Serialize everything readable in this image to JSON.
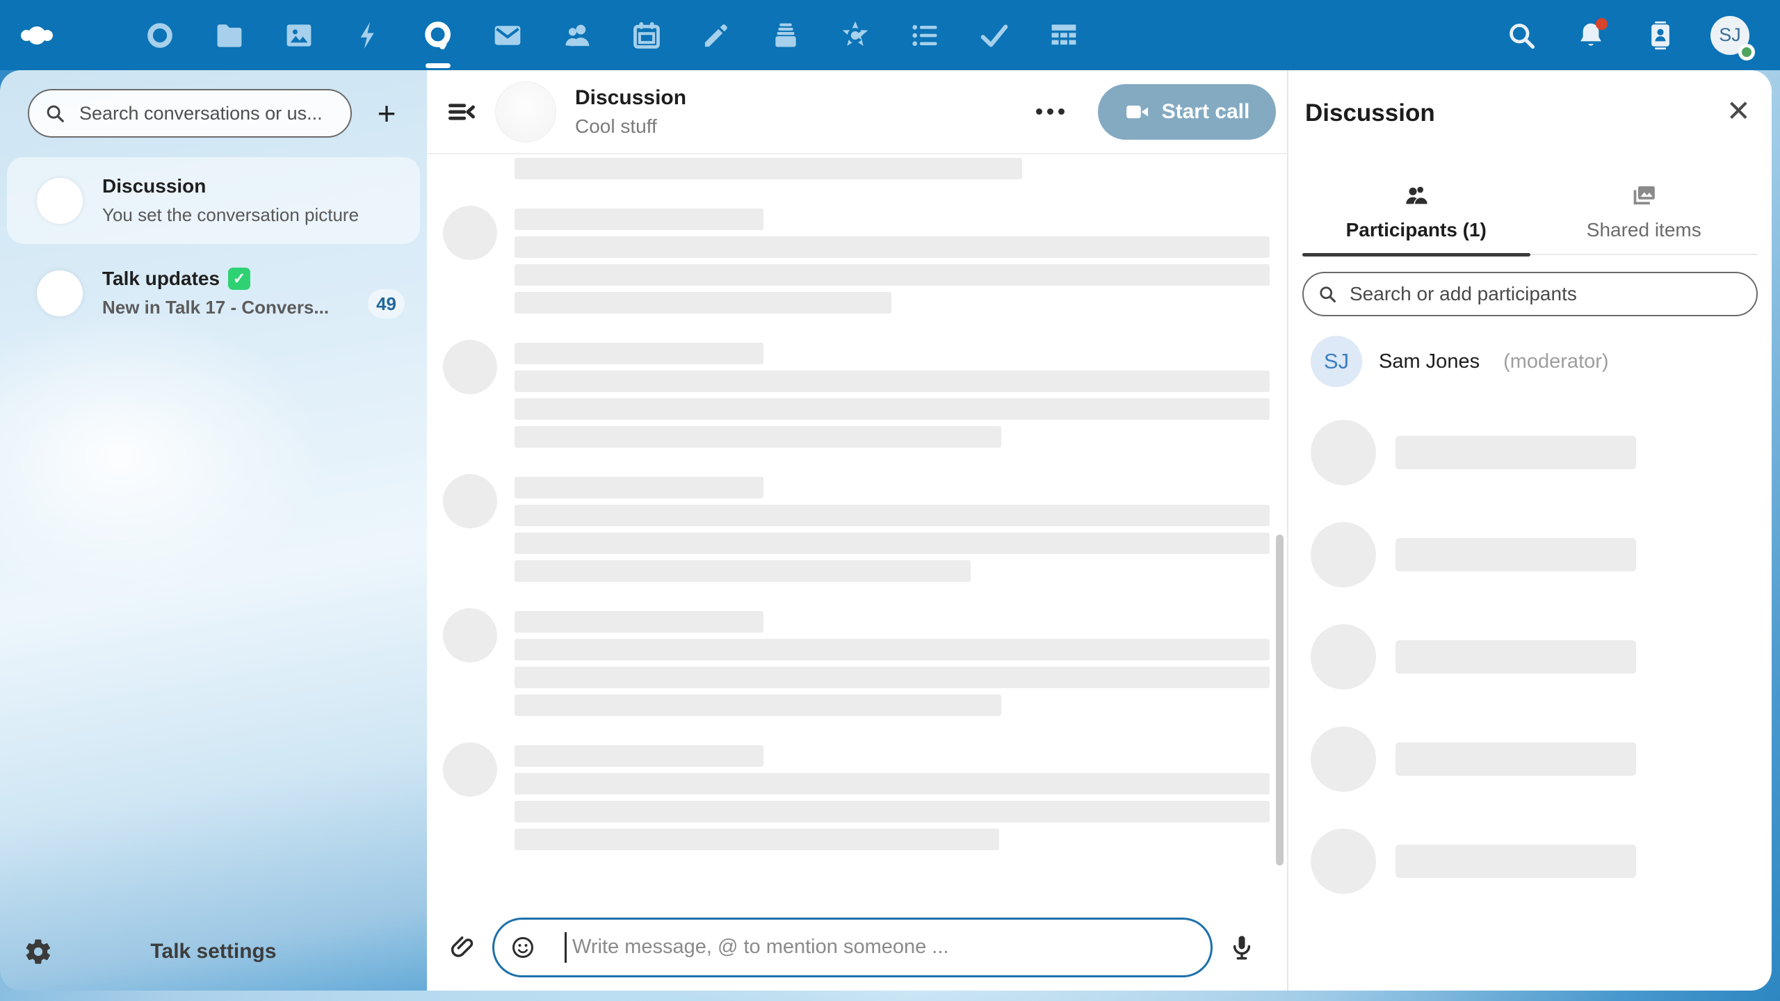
{
  "colors": {
    "primary_blue": "#0b73b6",
    "start_call_button": "#84aac2",
    "unread_badge_text": "#20689c",
    "check_badge_green": "#2fd273",
    "online_status_green": "#4fa45f",
    "notification_dot_red": "#d8432b",
    "selected_conversation_bg": "#dcebf6",
    "skeleton_gray": "#ececec"
  },
  "topbar": {
    "apps": [
      "dashboard",
      "files",
      "photos",
      "activity",
      "talk",
      "mail",
      "contacts",
      "calendar",
      "notes",
      "deck",
      "collectives",
      "tasks",
      "checks",
      "tables"
    ],
    "active_app": "talk",
    "right_icons": [
      "unified-search",
      "notifications",
      "contacts-menu",
      "account"
    ],
    "notifications_unread": true,
    "account_initials": "SJ",
    "account_status": "online"
  },
  "sidebar": {
    "search_placeholder": "Search conversations or us...",
    "new_conversation_label": "+",
    "conversations": [
      {
        "title": "Discussion",
        "subtitle": "You set the conversation picture",
        "selected": true
      },
      {
        "title": "Talk updates",
        "has_check_badge": true,
        "check_glyph": "✓",
        "subtitle": "New in Talk 17 - Convers...",
        "unread_count": "49",
        "selected": false
      }
    ],
    "footer_label": "Talk settings"
  },
  "chat": {
    "header": {
      "title": "Discussion",
      "subtitle": "Cool stuff",
      "start_call_label": "Start call"
    },
    "messages_loading_skeleton": true,
    "input_placeholder": "Write message, @ to mention someone ..."
  },
  "details": {
    "title": "Discussion",
    "close_glyph": "✕",
    "tabs": [
      {
        "label": "Participants (1)",
        "active": true
      },
      {
        "label": "Shared items",
        "active": false
      }
    ],
    "search_placeholder": "Search or add participants",
    "participants": [
      {
        "initials": "SJ",
        "name": "Sam Jones",
        "role": "(moderator)"
      }
    ],
    "participants_loading_skeleton_rows": 5
  }
}
